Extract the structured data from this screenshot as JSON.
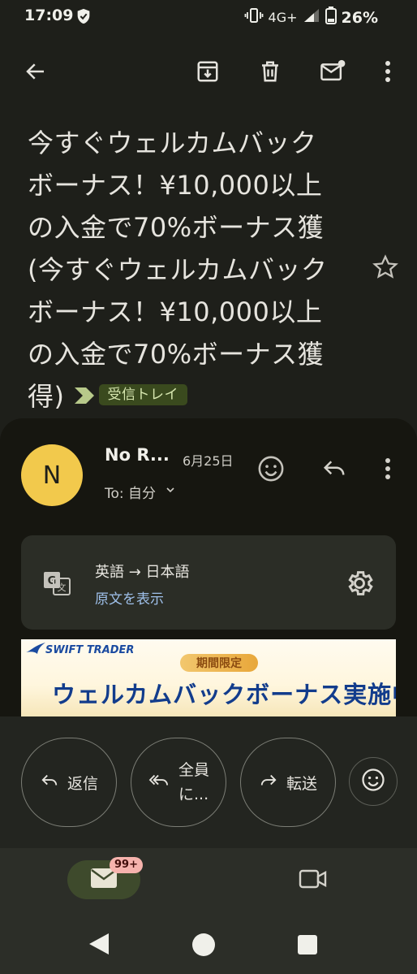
{
  "status_bar": {
    "time": "17:09",
    "network": "4G+",
    "battery": "26%"
  },
  "toolbar": {
    "back_icon": "arrow-left-icon",
    "archive_icon": "archive-icon",
    "delete_icon": "trash-icon",
    "mark_unread_icon": "mail-unread-icon",
    "more_icon": "more-vert-icon"
  },
  "subject": {
    "lines": [
      "今すぐウェルカムバック",
      "ボーナス！¥10,000以上",
      "の入金で70%ボーナス獲",
      "(今すぐウェルカムバック",
      "ボーナス！¥10,000以上",
      "の入金で70%ボーナス獲",
      "得)"
    ],
    "label": "受信トレイ"
  },
  "message": {
    "avatar_letter": "N",
    "sender": "No R...",
    "date": "6月25日",
    "to": "To: 自分"
  },
  "translation": {
    "languages": "英語 → 日本語",
    "show_original": "原文を表示"
  },
  "banner": {
    "logo": "SWIFT TRADER",
    "badge": "期間限定",
    "headline": "ウェルカムバックボーナス実施中"
  },
  "actions": {
    "reply": "返信",
    "reply_all_line1": "全員",
    "reply_all_line2": "に...",
    "forward": "転送"
  },
  "bottom_nav": {
    "mail_badge": "99+"
  },
  "colors": {
    "background": "#1e1f1a",
    "label_chip": "#3a4a1e",
    "avatar": "#f2c94c",
    "link": "#9fc0ea"
  }
}
